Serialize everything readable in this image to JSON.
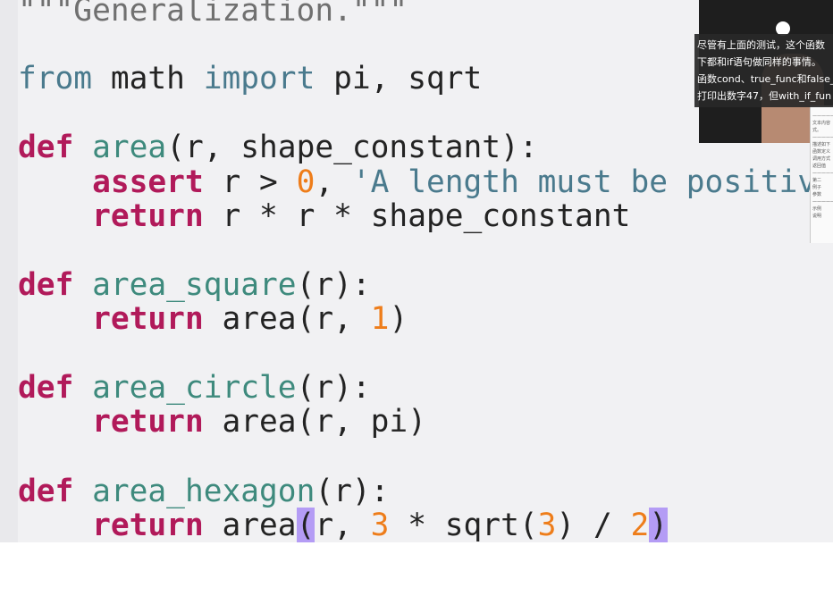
{
  "code": {
    "docstring_line": "\"\"\"Generalization.\"\"\"",
    "line_import": {
      "from": "from",
      "module": " math ",
      "import": "import",
      "names": " pi, sqrt"
    },
    "line_def_area": {
      "def": "def",
      "name": "area",
      "params": "(r, shape_constant):"
    },
    "line_assert": {
      "assert": "assert",
      "cond": " r > ",
      "zero": "0",
      "comma": ", ",
      "message": "'A length must be positive"
    },
    "line_return_area": {
      "return": "return",
      "expr": " r * r * shape_constant"
    },
    "line_def_square": {
      "def": "def",
      "name": "area_square",
      "params": "(r):"
    },
    "line_return_square": {
      "return": "return",
      "expr": " area(r, ",
      "num": "1",
      "close": ")"
    },
    "line_def_circle": {
      "def": "def",
      "name": "area_circle",
      "params": "(r):"
    },
    "line_return_circle": {
      "return": "return",
      "expr": " area(r, pi)"
    },
    "line_def_hexagon": {
      "def": "def",
      "name": "area_hexagon",
      "params": "(r):"
    },
    "line_return_hexagon": {
      "return": "return",
      "pre": " area",
      "open_paren": "(",
      "mid1": "r, ",
      "num3a": "3",
      "mid2": " * sqrt(",
      "num3b": "3",
      "mid3": ") / ",
      "num2": "2",
      "close_paren": ")"
    }
  },
  "subtitle": {
    "lines": [
      "尽管有上面的测试，这个函数",
      "下都和if语句做同样的事情。",
      "函数cond、true_func和false_",
      "打印出数字47，但with_if_fun"
    ]
  },
  "colors": {
    "keyword": "#b11a5a",
    "function_name": "#3e8a7d",
    "number": "#ee7d1a",
    "string": "#4a7a8d",
    "bracket_highlight": "#b49cf5",
    "editor_bg": "#f1f1f3"
  }
}
